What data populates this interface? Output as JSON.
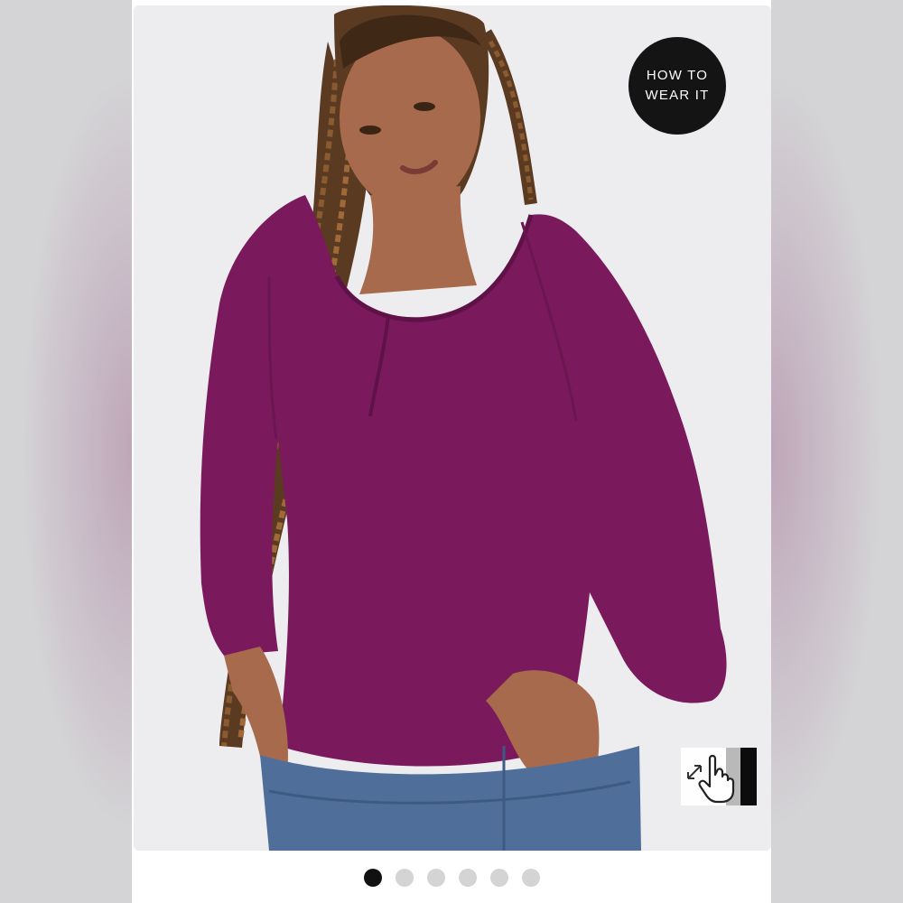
{
  "badge": {
    "line1": "HOW TO",
    "line2": "WEAR IT"
  },
  "icons": {
    "zoom": "expand-arrows-icon",
    "pointer": "hand-pointer-icon"
  },
  "carousel": {
    "total": 6,
    "active_index": 0
  },
  "colors": {
    "top": "#7a1a5c",
    "badge_bg": "#141414",
    "dot_active": "#111111",
    "dot_inactive": "#d4d4d4",
    "jeans": "#4f6f9a"
  }
}
